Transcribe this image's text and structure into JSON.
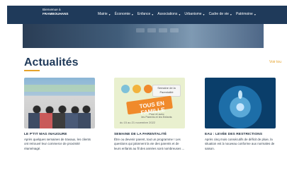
{
  "header": {
    "logo_line1": "Bienvenue à",
    "logo_line2": "FRAMBOUHANS",
    "nav": [
      {
        "label": "Mairie"
      },
      {
        "label": "Économie"
      },
      {
        "label": "Enfance"
      },
      {
        "label": "Associations"
      },
      {
        "label": "Urbanisme"
      },
      {
        "label": "Cadre de vie"
      },
      {
        "label": "Patrimoine"
      }
    ]
  },
  "main": {
    "section_title": "Actualités",
    "see_all": "Voir tou"
  },
  "cards": [
    {
      "title": "LE P'TIT MAG INAUGURE",
      "text": "Après quelques semaines de travaux, les clients ont retrouvé leur commerce de proximité réaménagé."
    },
    {
      "title": "SEMAINE DE LA PARENTALITÉ",
      "text": "Être ou devenir parent, tout un programme ! Les questions qui jalonnent la vie des parents et de leurs enfants au fil des années sont nombreuses ..."
    },
    {
      "title": "EAU : LEVÉE DES RESTRICTIONS",
      "text": "Après cinq mois consécutifs de déficit de pluie, la situation est à nouveau conforme aux normales de saison."
    }
  ],
  "card2_image": {
    "banner": "TOUS EN FAMILLE",
    "badge_line1": "Semaine de la",
    "badge_line2": "Parentalité",
    "subtitle_line1": "Pour et avec",
    "subtitle_line2": "les Parents et les Enfants",
    "bottom": "du 15 au 21 novembre 2022"
  }
}
